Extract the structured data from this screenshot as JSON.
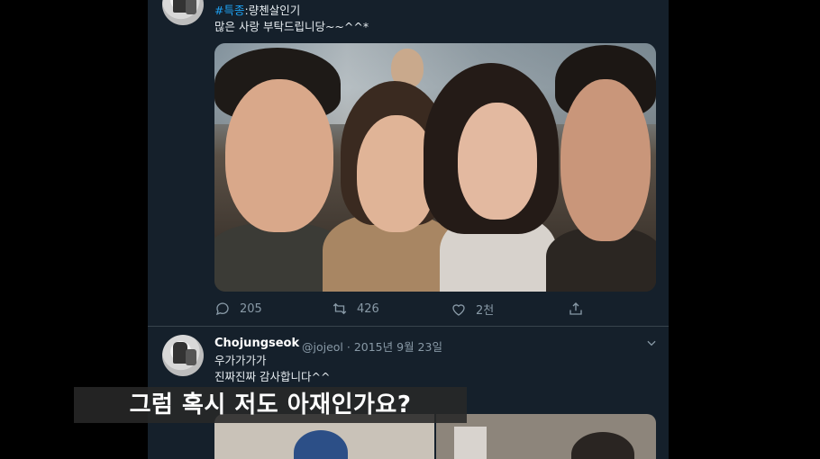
{
  "tweet1": {
    "hashtag": "#특종",
    "text_after_hashtag": ":량첸살인기",
    "line2": "많은 사랑 부탁드립니당~~^^*",
    "actions": {
      "reply_count": "205",
      "retweet_count": "426",
      "like_count": "2천"
    }
  },
  "tweet2": {
    "name": "Chojungseok",
    "handle_and_date": "@jojeol · 2015년 9월 23일",
    "line1": "우가가가가",
    "line2": "진짜진짜 감사합니다^^"
  },
  "subtitle": "그럼 혹시 저도 아재인가요?",
  "colors": {
    "background": "#15202b",
    "outside": "#000000",
    "accent": "#1da1f2",
    "muted": "#8899a6"
  },
  "icons": {
    "reply": "reply-icon",
    "retweet": "retweet-icon",
    "like": "like-icon",
    "share": "share-icon",
    "more": "chevron-down-icon"
  }
}
